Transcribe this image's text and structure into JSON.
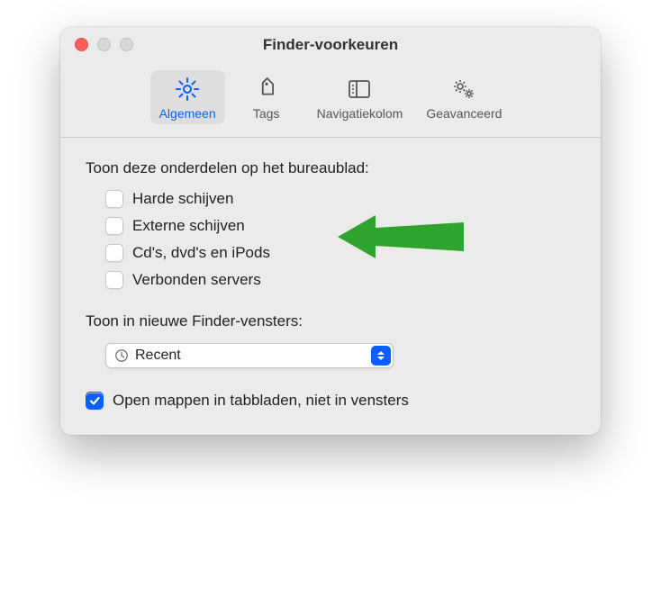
{
  "window": {
    "title": "Finder-voorkeuren"
  },
  "toolbar": {
    "items": [
      {
        "label": "Algemeen",
        "icon": "gear",
        "active": true
      },
      {
        "label": "Tags",
        "icon": "tag",
        "active": false
      },
      {
        "label": "Navigatiekolom",
        "icon": "sidebar",
        "active": false
      },
      {
        "label": "Geavanceerd",
        "icon": "gears",
        "active": false
      }
    ]
  },
  "desktop_section": {
    "heading": "Toon deze onderdelen op het bureaublad:",
    "items": [
      {
        "label": "Harde schijven",
        "checked": false
      },
      {
        "label": "Externe schijven",
        "checked": false
      },
      {
        "label": "Cd's, dvd's en iPods",
        "checked": false
      },
      {
        "label": "Verbonden servers",
        "checked": false
      }
    ]
  },
  "new_window_section": {
    "heading": "Toon in nieuwe Finder-vensters:",
    "selected": "Recent"
  },
  "tabs_checkbox": {
    "label": "Open mappen in tabbladen, niet in vensters",
    "checked": true
  }
}
